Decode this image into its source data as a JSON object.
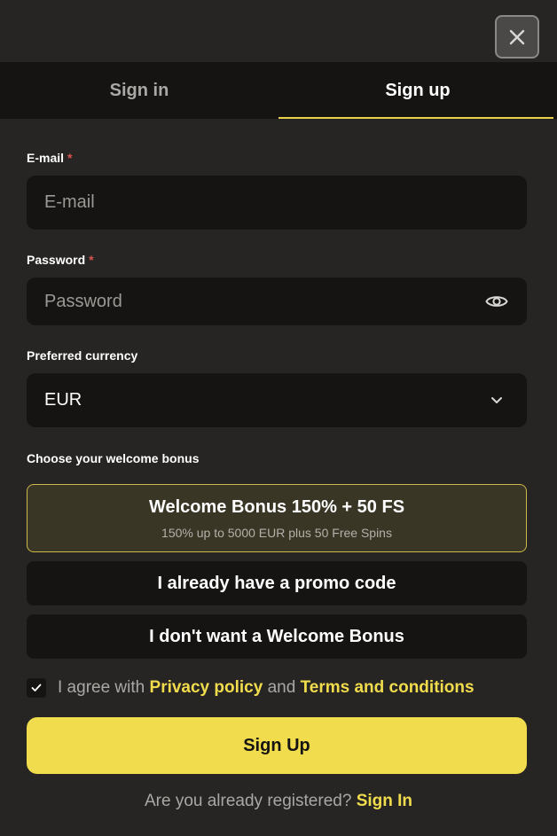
{
  "tabs": {
    "signin": "Sign in",
    "signup": "Sign up",
    "active": "signup"
  },
  "email": {
    "label": "E-mail",
    "required_mark": "*",
    "placeholder": "E-mail",
    "value": ""
  },
  "password": {
    "label": "Password",
    "required_mark": "*",
    "placeholder": "Password",
    "value": ""
  },
  "currency": {
    "label": "Preferred currency",
    "selected": "EUR"
  },
  "bonus": {
    "label": "Choose your welcome bonus",
    "options": [
      {
        "title": "Welcome Bonus 150% + 50 FS",
        "subtitle": "150% up to 5000 EUR plus 50 Free Spins",
        "selected": true
      },
      {
        "title": "I already have a promo code",
        "selected": false
      },
      {
        "title": "I don't want a Welcome Bonus",
        "selected": false
      }
    ]
  },
  "agreement": {
    "checked": true,
    "prefix": "I agree with",
    "privacy_link": "Privacy policy",
    "and": "and",
    "terms_link": "Terms and conditions"
  },
  "submit_label": "Sign Up",
  "footer": {
    "question": "Are you already registered?",
    "link": "Sign In"
  },
  "colors": {
    "accent": "#f0dc4c",
    "background": "#262523",
    "field": "#151412",
    "required": "#d9534f"
  },
  "icons": {
    "close": "close-icon",
    "eye": "eye-icon",
    "chevron": "chevron-down-icon",
    "check": "check-icon"
  }
}
